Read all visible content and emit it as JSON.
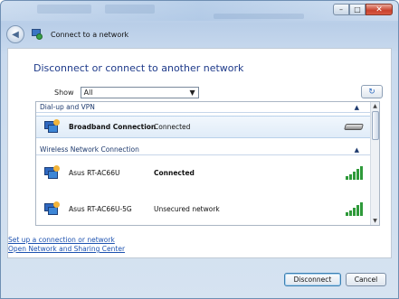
{
  "window": {
    "title": "Connect to a network",
    "caption_buttons": {
      "minimize": "–",
      "maximize": "□",
      "close": "✕"
    }
  },
  "nav": {
    "back_glyph": "◀"
  },
  "main": {
    "heading": "Disconnect or connect to another network",
    "show_label": "Show",
    "show_value": "All",
    "show_arrow": "▼",
    "refresh_glyph": "↻"
  },
  "list": {
    "groups": [
      {
        "label": "Dial-up and VPN",
        "caret": "▲",
        "items": [
          {
            "name": "Broadband Connection",
            "status": "Connected",
            "icon": "broadband-icon",
            "selected": true
          }
        ]
      },
      {
        "label": "Wireless Network Connection",
        "caret": "▲",
        "items": [
          {
            "name": "Asus RT-AC66U",
            "status": "Connected",
            "icon": "wifi-signal-icon",
            "signal_bars": 5
          },
          {
            "name": "Asus RT-AC66U-5G",
            "status": "Unsecured network",
            "icon": "wifi-signal-icon",
            "signal_bars": 5
          }
        ]
      }
    ],
    "scroll_up": "▲",
    "scroll_down": "▼"
  },
  "links": {
    "setup": "Set up a connection or network",
    "sharing_center": "Open Network and Sharing Center"
  },
  "footer": {
    "disconnect_label": "Disconnect",
    "cancel_label": "Cancel"
  },
  "colors": {
    "heading": "#1e3a8a",
    "link": "#1d52b0",
    "signal": "#2f9a3a"
  }
}
